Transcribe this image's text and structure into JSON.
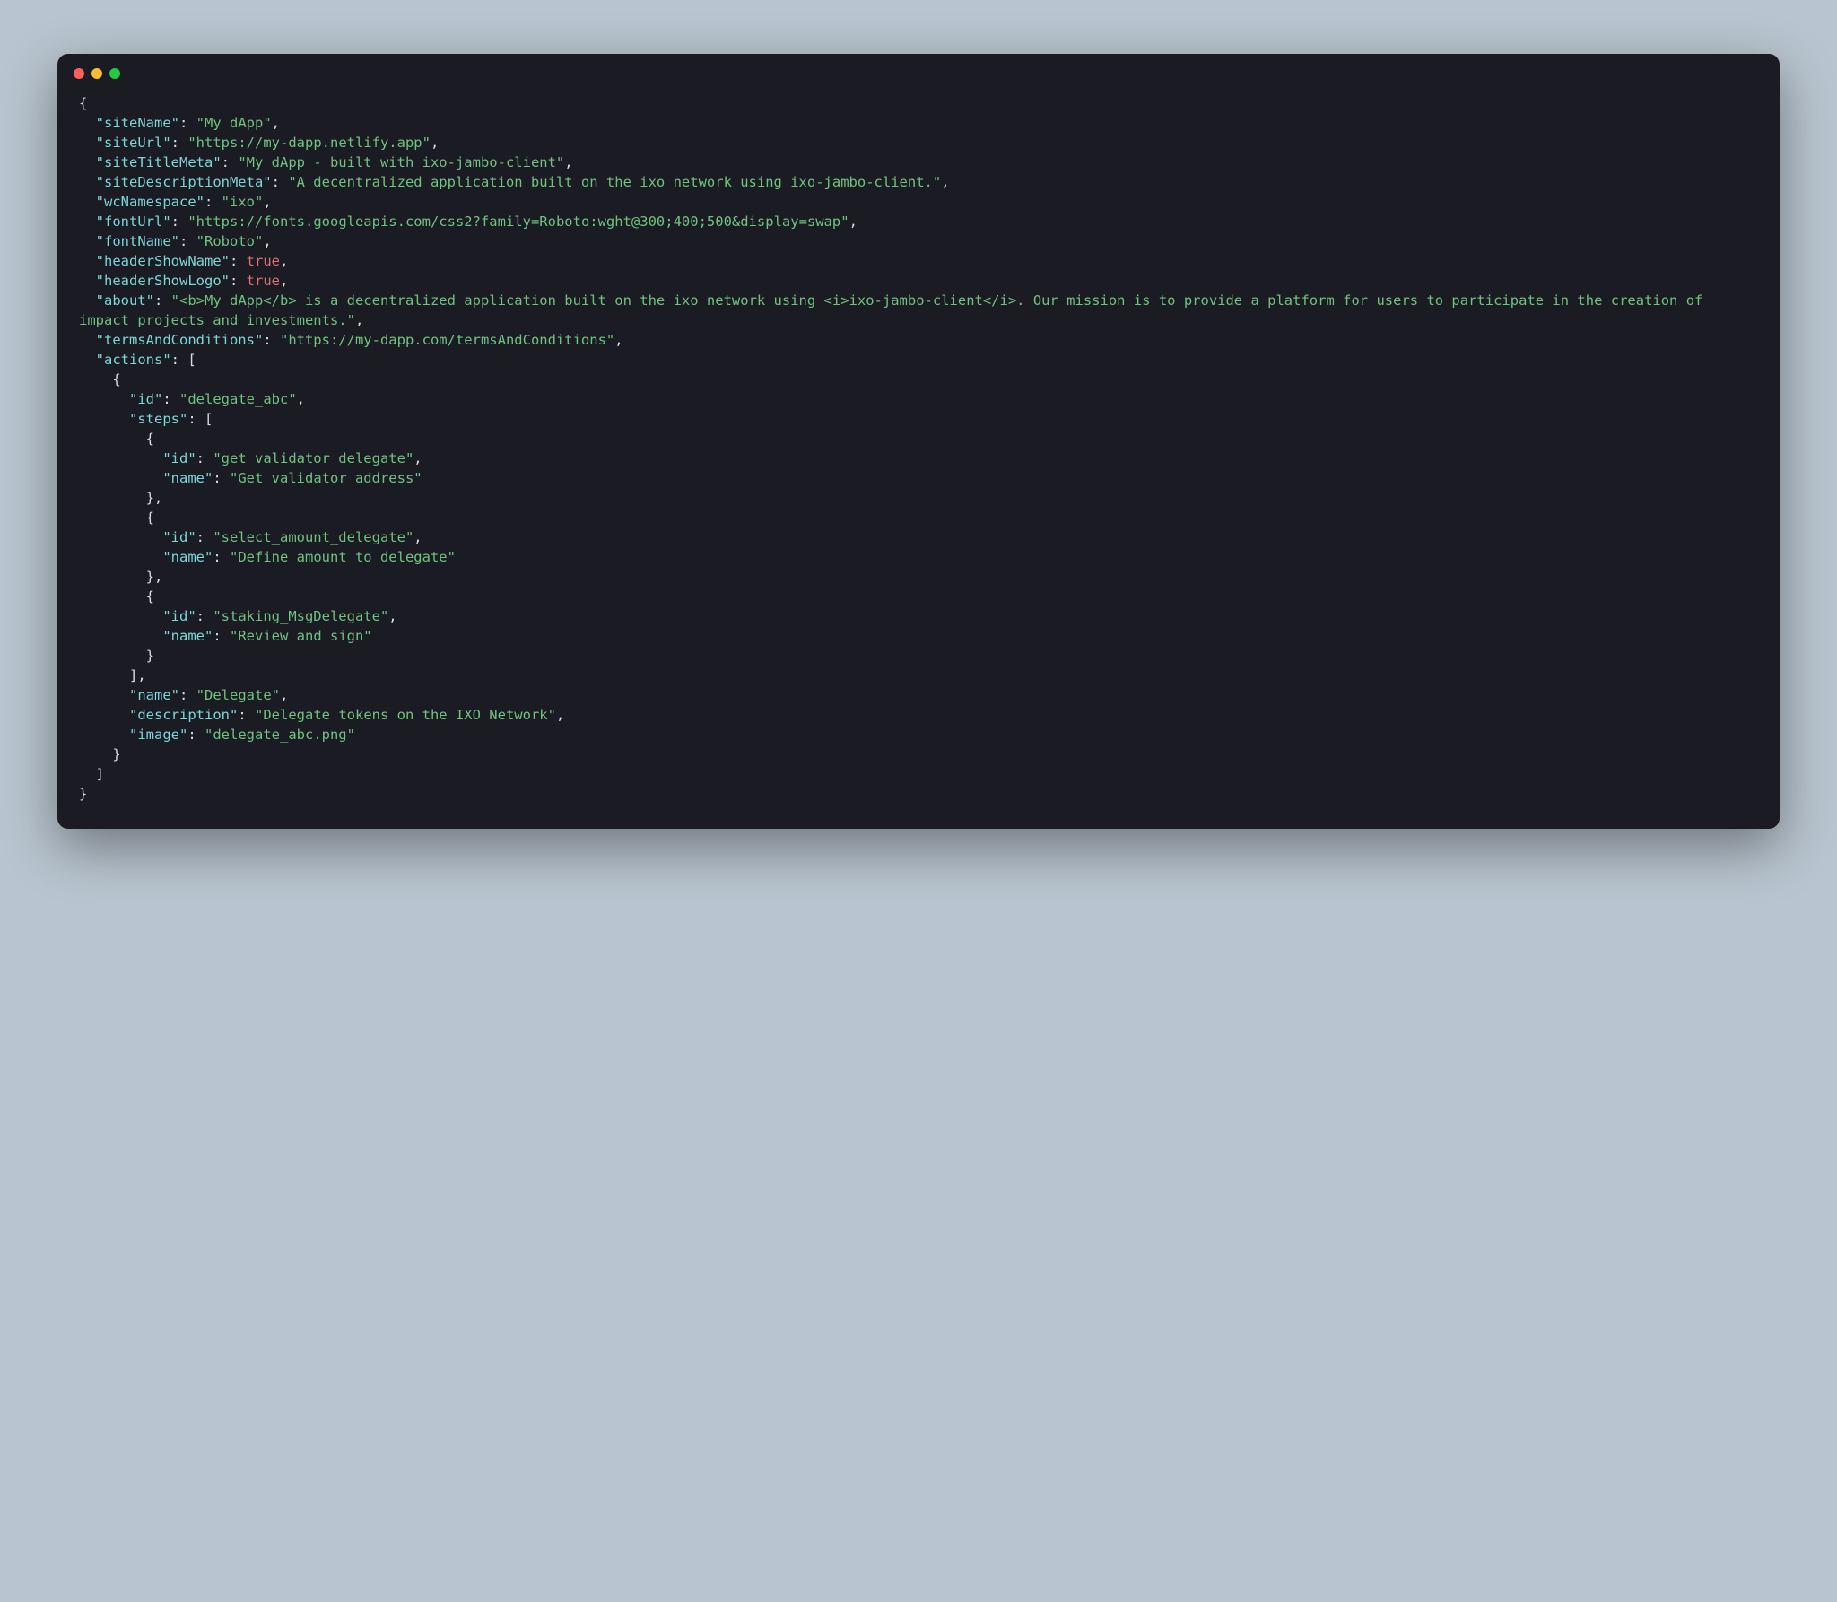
{
  "colors": {
    "background": "#b8c4cf",
    "window_bg": "#1a1b23",
    "dot_red": "#ff5f56",
    "dot_yellow": "#ffbd2e",
    "dot_green": "#27c93f",
    "punct": "#d8dce4",
    "key": "#7cd5d7",
    "string": "#70c27f",
    "bool": "#e06c75"
  },
  "code_json": {
    "siteName": "My dApp",
    "siteUrl": "https://my-dapp.netlify.app",
    "siteTitleMeta": "My dApp - built with ixo-jambo-client",
    "siteDescriptionMeta": "A decentralized application built on the ixo network using ixo-jambo-client.",
    "wcNamespace": "ixo",
    "fontUrl": "https://fonts.googleapis.com/css2?family=Roboto:wght@300;400;500&display=swap",
    "fontName": "Roboto",
    "headerShowName": true,
    "headerShowLogo": true,
    "about": "<b>My dApp</b> is a decentralized application built on the ixo network using <i>ixo-jambo-client</i>. Our mission is to provide a platform for users to participate in the creation of impact projects and investments.",
    "termsAndConditions": "https://my-dapp.com/termsAndConditions",
    "actions": [
      {
        "id": "delegate_abc",
        "steps": [
          {
            "id": "get_validator_delegate",
            "name": "Get validator address"
          },
          {
            "id": "select_amount_delegate",
            "name": "Define amount to delegate"
          },
          {
            "id": "staking_MsgDelegate",
            "name": "Review and sign"
          }
        ],
        "name": "Delegate",
        "description": "Delegate tokens on the IXO Network",
        "image": "delegate_abc.png"
      }
    ]
  },
  "key_order": [
    "siteName",
    "siteUrl",
    "siteTitleMeta",
    "siteDescriptionMeta",
    "wcNamespace",
    "fontUrl",
    "fontName",
    "headerShowName",
    "headerShowLogo",
    "about",
    "termsAndConditions",
    "actions"
  ],
  "action_key_order": [
    "id",
    "steps",
    "name",
    "description",
    "image"
  ],
  "step_key_order": [
    "id",
    "name"
  ]
}
